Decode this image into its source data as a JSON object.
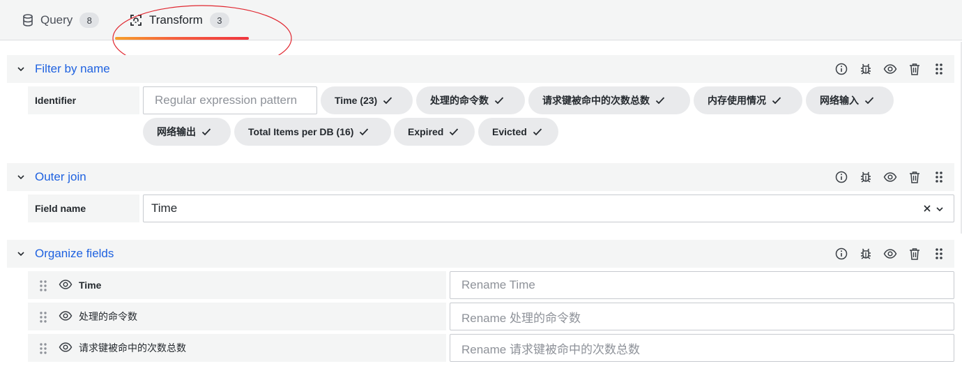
{
  "tabs": [
    {
      "label": "Query",
      "count": "8",
      "icon": "database-icon"
    },
    {
      "label": "Transform",
      "count": "3",
      "icon": "transform-icon"
    }
  ],
  "colors": {
    "accent_blue": "#1f62e0",
    "tab_underline_start": "#f6a02a",
    "tab_underline_end": "#f0353e",
    "annotation_red": "#e0262f",
    "section_bg": "#f4f5f5",
    "pill_bg": "#e9eaec"
  },
  "section_actions": [
    "info-icon",
    "debug-icon",
    "eye-icon",
    "trash-icon",
    "drag-handle-icon"
  ],
  "filter_by_name": {
    "title": "Filter by name",
    "identifier_label": "Identifier",
    "regex_placeholder": "Regular expression pattern",
    "fields": [
      "Time (23)",
      "处理的命令数",
      "请求键被命中的次数总数",
      "内存使用情况",
      "网络输入",
      "网络输出",
      "Total Items per DB (16)",
      "Expired",
      "Evicted"
    ]
  },
  "outer_join": {
    "title": "Outer join",
    "field_name_label": "Field name",
    "field_value": "Time"
  },
  "organize_fields": {
    "title": "Organize fields",
    "rows": [
      {
        "name": "Time",
        "rename_placeholder": "Rename Time"
      },
      {
        "name": "处理的命令数",
        "rename_placeholder": "Rename 处理的命令数"
      },
      {
        "name": "请求键被命中的次数总数",
        "rename_placeholder": "Rename 请求键被命中的次数总数"
      }
    ]
  }
}
